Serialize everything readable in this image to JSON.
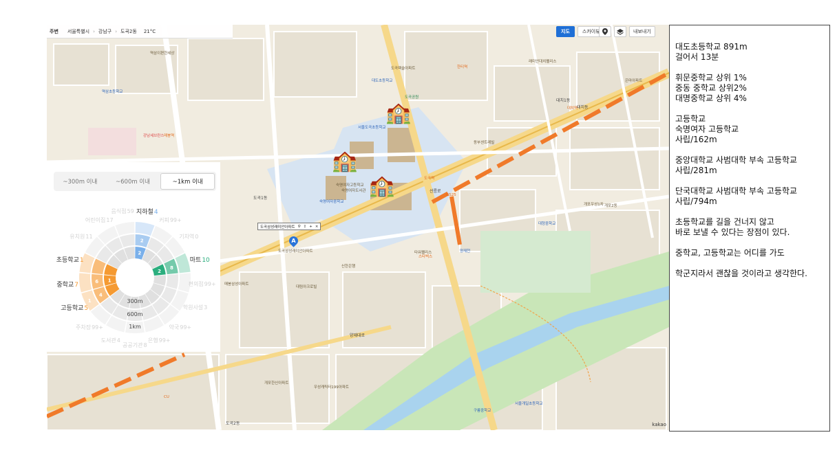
{
  "breadcrumb": {
    "home": "주변",
    "city": "서울특별시",
    "district": "강남구",
    "dong": "도곡2동",
    "weather": "21°C"
  },
  "map_controls": {
    "map_label": "지도",
    "skyview_label": "스카이뷰",
    "share_label": "내보내기",
    "pin_icon": "pin-icon",
    "layers_icon": "layers-icon"
  },
  "place_popup": "도곡삼성래미안아파트",
  "marker_A": "A",
  "attribution": "kakao",
  "map_labels": [
    {
      "t": "서울도곡초등학교",
      "c": "blue"
    },
    {
      "t": "숙명여자고등학교",
      "c": ""
    },
    {
      "t": "숙명여자도서관",
      "c": ""
    },
    {
      "t": "숙명여자중학교",
      "c": "blue"
    },
    {
      "t": "대도초등학교",
      "c": "blue"
    },
    {
      "t": "도곡렉슬아파트",
      "c": ""
    },
    {
      "t": "도곡역",
      "c": "orange"
    },
    {
      "t": "대치역",
      "c": "orange"
    },
    {
      "t": "한티역",
      "c": "orange"
    },
    {
      "t": "매봉역",
      "c": "orange"
    },
    {
      "t": "타워팰리스",
      "c": ""
    },
    {
      "t": "도곡삼성래미안아파트",
      "c": ""
    },
    {
      "t": "대치1동",
      "c": "dark"
    },
    {
      "t": "도곡2동",
      "c": "dark"
    },
    {
      "t": "대청중학교",
      "c": "blue"
    },
    {
      "t": "대치동",
      "c": "dark"
    },
    {
      "t": "양재천",
      "c": "blue"
    },
    {
      "t": "개포2동",
      "c": ""
    },
    {
      "t": "개포한신아파트",
      "c": ""
    },
    {
      "t": "우성캐릭터199아파트",
      "c": ""
    },
    {
      "t": "서울개일초등학교",
      "c": "blue"
    },
    {
      "t": "구룡중학교",
      "c": "blue"
    },
    {
      "t": "남부순환로",
      "c": "dark"
    },
    {
      "t": "양재대로",
      "c": "dark"
    },
    {
      "t": "선릉로",
      "c": "dark"
    },
    {
      "t": "GS25",
      "c": "orange"
    },
    {
      "t": "CU",
      "c": "orange"
    },
    {
      "t": "스타벅스",
      "c": "orange"
    },
    {
      "t": "신한은행",
      "c": ""
    },
    {
      "t": "대림아크로빌",
      "c": ""
    },
    {
      "t": "래미안대치팰리스",
      "c": ""
    },
    {
      "t": "은마아파트",
      "c": ""
    },
    {
      "t": "개포우성1차",
      "c": ""
    },
    {
      "t": "도곡공원",
      "c": "green"
    },
    {
      "t": "역삼초등학교",
      "c": "blue"
    },
    {
      "t": "역삼이편한세상",
      "c": ""
    },
    {
      "t": "강남세브란스",
      "c": "red"
    },
    {
      "t": "매봉삼성아파트",
      "c": ""
    },
    {
      "t": "동부센트레빌",
      "c": ""
    },
    {
      "t": "도곡1동",
      "c": "dark"
    }
  ],
  "radius_panel": {
    "tabs": [
      "~300m 이내",
      "~600m 이내",
      "~1km 이내"
    ],
    "active_tab": 2,
    "ring_labels": [
      "300m",
      "600m",
      "1km"
    ],
    "categories": [
      {
        "name": "지하철",
        "count": "4",
        "active": true
      },
      {
        "name": "커피",
        "count": "99+",
        "active": false
      },
      {
        "name": "기차역",
        "count": "0",
        "active": false
      },
      {
        "name": "마트",
        "count": "10",
        "active": true
      },
      {
        "name": "편의점",
        "count": "99+",
        "active": false
      },
      {
        "name": "학원사설",
        "count": "3",
        "active": false
      },
      {
        "name": "약국",
        "count": "99+",
        "active": false
      },
      {
        "name": "은행",
        "count": "99+",
        "active": false
      },
      {
        "name": "공공기관",
        "count": "8",
        "active": false
      },
      {
        "name": "도서관",
        "count": "4",
        "active": false
      },
      {
        "name": "주차장",
        "count": "99+",
        "active": false
      },
      {
        "name": "고등학교",
        "count": "5",
        "active": true
      },
      {
        "name": "중학교",
        "count": "7",
        "active": true
      },
      {
        "name": "초등학교",
        "count": "1",
        "active": true
      },
      {
        "name": "유치원",
        "count": "11",
        "active": false
      },
      {
        "name": "어린이집",
        "count": "17",
        "active": false
      },
      {
        "name": "음식점",
        "count": "59",
        "active": false
      }
    ],
    "wedge_numbers": {
      "subway_inner": "2",
      "subway_mid": "2",
      "mart_inner": "2",
      "mart_mid": "8",
      "middle_inner": "1",
      "middle_mid": "6",
      "high_mid": "4",
      "high_outer": "1"
    },
    "colors": {
      "subway": "#7ab0ea",
      "mart": "#2bae7e",
      "school": "#f59a32",
      "inactive": "#e6e6e6"
    }
  },
  "notes": [
    "대도초등학교 891m\n걸어서 13분",
    "휘문중학교 상위 1%\n중동 중학교 상위2%\n대명중학교 상위 4%",
    "고등학교\n숙명여자 고등학교\n사립/162m",
    "중앙대학교 사범대학 부속 고등학교\n사립/281m",
    "단국대학교 사범대학 부속 고등학교\n사립/794m",
    "초등학교를 길을 건너지 않고\n바로 보낼 수 있다는 장점이 있다.",
    "중학교, 고등학교는 어디를 가도",
    "학군지라서 괜찮을 것이라고 생각한다."
  ]
}
